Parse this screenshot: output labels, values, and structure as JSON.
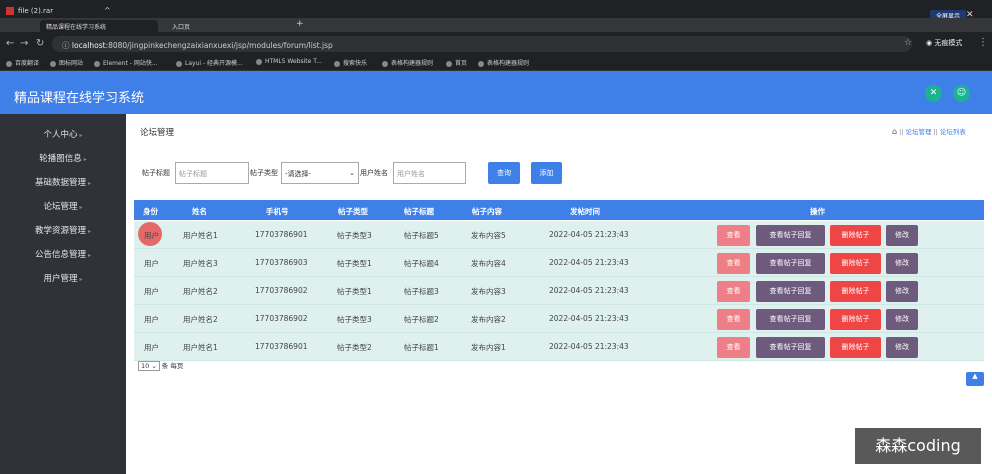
{
  "browser": {
    "file_tab": "file (2).rar",
    "tabs": [
      "精品课程在线学习系统",
      "入口页"
    ],
    "url_host": "localhost",
    "url_path": ":8080/jingpinkechengzaixianxuexi/jsp/modules/forum/list.jsp",
    "profile": "无痕模式",
    "fullscreen_label": "全屏显示",
    "bookmarks": [
      "百度翻译",
      "图标网站",
      "Element - 网站快...",
      "Layui - 经典开源模...",
      "HTML5 Website T...",
      "搜索快乐",
      "表格构建器规则",
      "首页",
      "表格构建器规则"
    ]
  },
  "app": {
    "title": "精品课程在线学习系统"
  },
  "sidebar": {
    "items": [
      "个人中心",
      "轮播图信息",
      "基础数据管理",
      "论坛管理",
      "教学资源管理",
      "公告信息管理",
      "用户管理"
    ]
  },
  "page": {
    "title": "论坛管理",
    "breadcrumb": [
      "论坛管理",
      "论坛列表"
    ]
  },
  "search": {
    "title_label": "帖子标题",
    "title_placeholder": "帖子标题",
    "type_label": "帖子类型",
    "type_selected": "-请选择-",
    "user_label": "用户姓名",
    "user_placeholder": "用户姓名",
    "query_button": "查询",
    "add_button": "添加"
  },
  "table": {
    "columns": [
      "身份",
      "姓名",
      "手机号",
      "帖子类型",
      "帖子标题",
      "帖子内容",
      "发帖时间",
      "操作"
    ],
    "rows": [
      [
        "用户",
        "用户姓名1",
        "17703786901",
        "帖子类型3",
        "帖子标题5",
        "发布内容5",
        "2022-04-05 21:23:43"
      ],
      [
        "用户",
        "用户姓名3",
        "17703786903",
        "帖子类型1",
        "帖子标题4",
        "发布内容4",
        "2022-04-05 21:23:43"
      ],
      [
        "用户",
        "用户姓名2",
        "17703786902",
        "帖子类型1",
        "帖子标题3",
        "发布内容3",
        "2022-04-05 21:23:43"
      ],
      [
        "用户",
        "用户姓名2",
        "17703786902",
        "帖子类型3",
        "帖子标题2",
        "发布内容2",
        "2022-04-05 21:23:43"
      ],
      [
        "用户",
        "用户姓名1",
        "17703786901",
        "帖子类型2",
        "帖子标题1",
        "发布内容1",
        "2022-04-05 21:23:43"
      ]
    ],
    "actions": {
      "view": "查看",
      "view_replies": "查看帖子回复",
      "delete": "删除帖子",
      "edit": "修改"
    }
  },
  "pager": {
    "page_size": "10",
    "per_page_label": "条 每页"
  },
  "watermark": "森森coding",
  "colors": {
    "header": "#3f7fe8",
    "sidebar": "#2f3238",
    "row_bg": "#dff1ee",
    "view_btn": "#ef7f86",
    "reply_btn": "#6d5a7d",
    "delete_btn": "#f04545"
  }
}
